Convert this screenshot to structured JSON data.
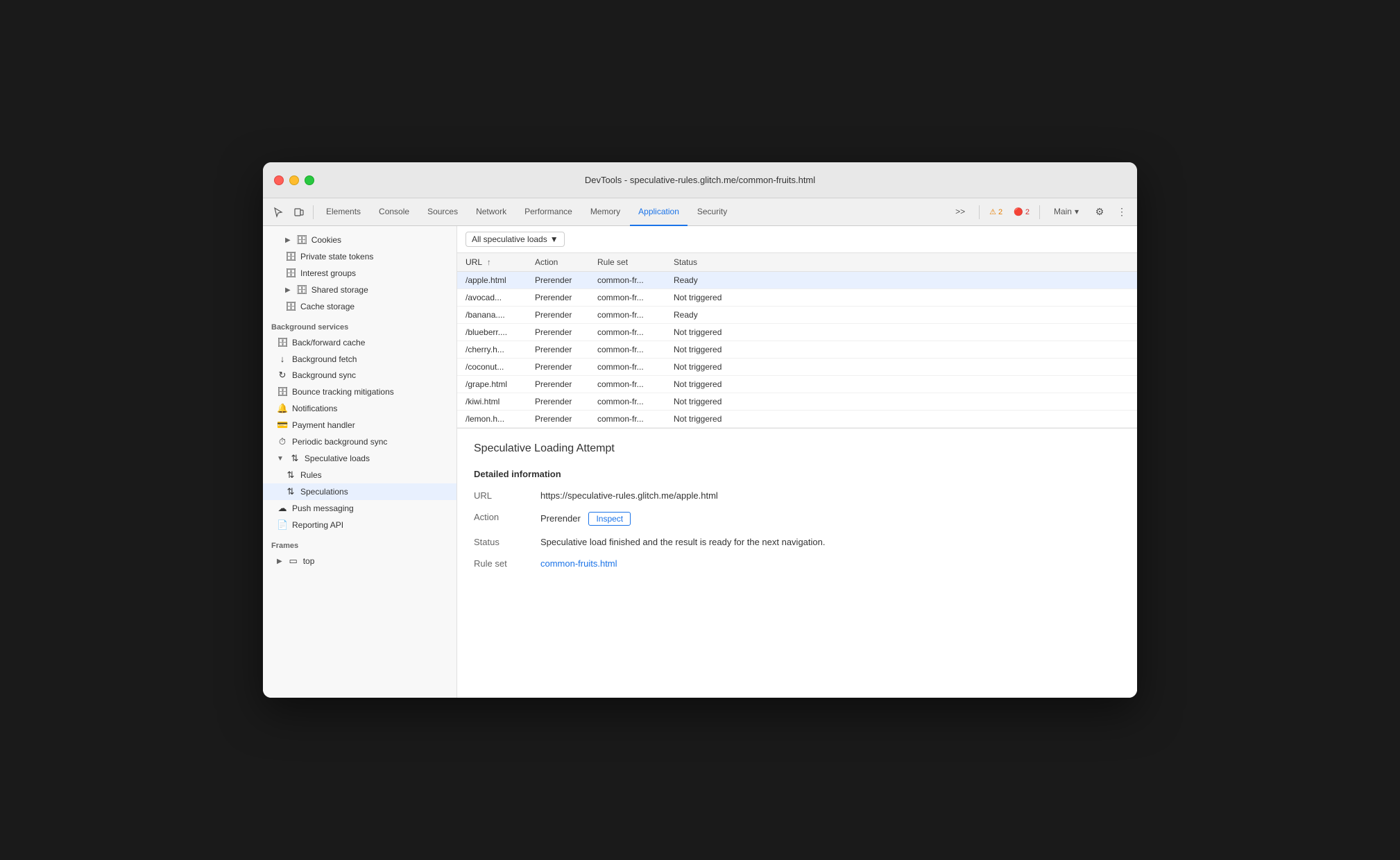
{
  "window": {
    "title": "DevTools - speculative-rules.glitch.me/common-fruits.html"
  },
  "toolbar": {
    "tabs": [
      {
        "id": "elements",
        "label": "Elements",
        "active": false
      },
      {
        "id": "console",
        "label": "Console",
        "active": false
      },
      {
        "id": "sources",
        "label": "Sources",
        "active": false
      },
      {
        "id": "network",
        "label": "Network",
        "active": false
      },
      {
        "id": "performance",
        "label": "Performance",
        "active": false
      },
      {
        "id": "memory",
        "label": "Memory",
        "active": false
      },
      {
        "id": "application",
        "label": "Application",
        "active": true
      },
      {
        "id": "security",
        "label": "Security",
        "active": false
      }
    ],
    "more_tabs": ">>",
    "warn_count": "2",
    "error_count": "2",
    "main_label": "Main",
    "settings_icon": "⚙",
    "more_icon": "⋮"
  },
  "sidebar": {
    "groups": [
      {
        "label": "",
        "items": [
          {
            "id": "cookies",
            "label": "Cookies",
            "icon": "▶",
            "icon_type": "triangle",
            "db_icon": true,
            "indent": 1
          },
          {
            "id": "private-state-tokens",
            "label": "Private state tokens",
            "db_icon": true,
            "indent": 1
          },
          {
            "id": "interest-groups",
            "label": "Interest groups",
            "db_icon": true,
            "indent": 1
          },
          {
            "id": "shared-storage",
            "label": "Shared storage",
            "icon": "▶",
            "icon_type": "triangle",
            "db_icon": true,
            "indent": 1
          },
          {
            "id": "cache-storage",
            "label": "Cache storage",
            "db_icon": true,
            "indent": 1
          }
        ]
      },
      {
        "label": "Background services",
        "items": [
          {
            "id": "back-forward-cache",
            "label": "Back/forward cache",
            "db_icon": true
          },
          {
            "id": "background-fetch",
            "label": "Background fetch",
            "arrow_icon": true
          },
          {
            "id": "background-sync",
            "label": "Background sync",
            "sync_icon": true
          },
          {
            "id": "bounce-tracking",
            "label": "Bounce tracking mitigations",
            "db_icon": true
          },
          {
            "id": "notifications",
            "label": "Notifications",
            "bell_icon": true
          },
          {
            "id": "payment-handler",
            "label": "Payment handler",
            "card_icon": true
          },
          {
            "id": "periodic-background-sync",
            "label": "Periodic background sync",
            "sync_icon": true
          },
          {
            "id": "speculative-loads",
            "label": "Speculative loads",
            "arrow_icon": true,
            "expanded": true
          },
          {
            "id": "rules",
            "label": "Rules",
            "arrow_icon": true,
            "indent": 1
          },
          {
            "id": "speculations",
            "label": "Speculations",
            "arrow_icon": true,
            "indent": 1,
            "active": true
          },
          {
            "id": "push-messaging",
            "label": "Push messaging",
            "cloud_icon": true
          },
          {
            "id": "reporting-api",
            "label": "Reporting API",
            "doc_icon": true
          }
        ]
      },
      {
        "label": "Frames",
        "items": [
          {
            "id": "top",
            "label": "top",
            "icon": "▶",
            "icon_type": "triangle",
            "frame_icon": true
          }
        ]
      }
    ]
  },
  "main": {
    "filter": {
      "label": "All speculative loads",
      "dropdown_arrow": "▼"
    },
    "table": {
      "columns": [
        {
          "id": "url",
          "label": "URL",
          "sortable": true
        },
        {
          "id": "action",
          "label": "Action"
        },
        {
          "id": "ruleset",
          "label": "Rule set"
        },
        {
          "id": "status",
          "label": "Status"
        }
      ],
      "rows": [
        {
          "url": "/apple.html",
          "action": "Prerender",
          "ruleset": "common-fr...",
          "status": "Ready",
          "selected": true
        },
        {
          "url": "/avocad...",
          "action": "Prerender",
          "ruleset": "common-fr...",
          "status": "Not triggered",
          "selected": false
        },
        {
          "url": "/banana....",
          "action": "Prerender",
          "ruleset": "common-fr...",
          "status": "Ready",
          "selected": false
        },
        {
          "url": "/blueberr....",
          "action": "Prerender",
          "ruleset": "common-fr...",
          "status": "Not triggered",
          "selected": false
        },
        {
          "url": "/cherry.h...",
          "action": "Prerender",
          "ruleset": "common-fr...",
          "status": "Not triggered",
          "selected": false
        },
        {
          "url": "/coconut...",
          "action": "Prerender",
          "ruleset": "common-fr...",
          "status": "Not triggered",
          "selected": false
        },
        {
          "url": "/grape.html",
          "action": "Prerender",
          "ruleset": "common-fr...",
          "status": "Not triggered",
          "selected": false
        },
        {
          "url": "/kiwi.html",
          "action": "Prerender",
          "ruleset": "common-fr...",
          "status": "Not triggered",
          "selected": false
        },
        {
          "url": "/lemon.h...",
          "action": "Prerender",
          "ruleset": "common-fr...",
          "status": "Not triggered",
          "selected": false
        }
      ]
    },
    "detail": {
      "title": "Speculative Loading Attempt",
      "section_title": "Detailed information",
      "rows": [
        {
          "label": "URL",
          "value": "https://speculative-rules.glitch.me/apple.html"
        },
        {
          "label": "Action",
          "value": "Prerender",
          "has_button": true,
          "button_label": "Inspect"
        },
        {
          "label": "Status",
          "value": "Speculative load finished and the result is ready for the next navigation."
        },
        {
          "label": "Rule set",
          "value": "common-fruits.html",
          "is_link": true
        }
      ]
    }
  },
  "colors": {
    "accent": "#1a73e8",
    "selected_row_bg": "#e8f0fe",
    "selected_row_border": "#1a73e8"
  }
}
